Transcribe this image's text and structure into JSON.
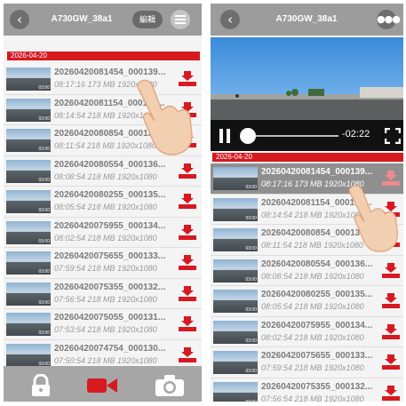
{
  "left": {
    "title": "A730GW_38a1",
    "edit_label": "編輯",
    "date": "2026-04-20",
    "items": [
      {
        "name": "20260420081454_000139...",
        "meta": "08:17:16 173 MB 1920x1080"
      },
      {
        "name": "20260420081154_000138...",
        "meta": "08:14:54 218 MB 1920x1080"
      },
      {
        "name": "20260420080854_000137...",
        "meta": "08:11:54 218 MB 1920x1080"
      },
      {
        "name": "20260420080554_000136...",
        "meta": "08:08:54 218 MB 1920x1080"
      },
      {
        "name": "20260420080255_000135...",
        "meta": "08:05:54 218 MB 1920x1080"
      },
      {
        "name": "20260420075955_000134...",
        "meta": "08:02:54 218 MB 1920x1080"
      },
      {
        "name": "20260420075655_000133...",
        "meta": "07:59:54 218 MB 1920x1080"
      },
      {
        "name": "20260420075355_000132...",
        "meta": "07:56:54 218 MB 1920x1080"
      },
      {
        "name": "20260420075055_000131...",
        "meta": "07:53:54 218 MB 1920x1080"
      },
      {
        "name": "20260420074754_000130...",
        "meta": "07:50:54 218 MB 1920x1080"
      }
    ]
  },
  "right": {
    "title": "A730GW_38a1",
    "remaining_time": "-02:22",
    "date": "2026-04-20",
    "items": [
      {
        "name": "20260420081454_000139...",
        "meta": "08:17:16 173 MB 1920x1080"
      },
      {
        "name": "20260420081154_000138...",
        "meta": "08:14:54 218 MB 1920x1080"
      },
      {
        "name": "20260420080854_000137...",
        "meta": "08:11:54 218 MB 1920x1080"
      },
      {
        "name": "20260420080554_000136...",
        "meta": "08:08:54 218 MB 1920x1080"
      },
      {
        "name": "20260420080255_000135...",
        "meta": "08:05:54 218 MB 1920x1080"
      },
      {
        "name": "20260420075955_000134...",
        "meta": "08:02:54 218 MB 1920x1080"
      },
      {
        "name": "20260420075655_000133...",
        "meta": "07:59:54 218 MB 1920x1080"
      },
      {
        "name": "20260420075355_000132...",
        "meta": "07:56:54 218 MB 1920x1080"
      }
    ]
  },
  "thumb_duration": "03:00",
  "icons": {
    "back": "back-arrow-icon",
    "list_view": "list-view-icon",
    "more": "more-dots-icon",
    "download": "download-icon",
    "lock": "lock-icon",
    "video": "video-camera-icon",
    "photo": "camera-icon",
    "pause": "pause-icon",
    "fullscreen": "fullscreen-icon",
    "hand": "tap-hand-icon"
  },
  "colors": {
    "accent_red": "#d71920",
    "header_gray": "#9c9c9c",
    "selected_row": "#8f8f8f"
  }
}
